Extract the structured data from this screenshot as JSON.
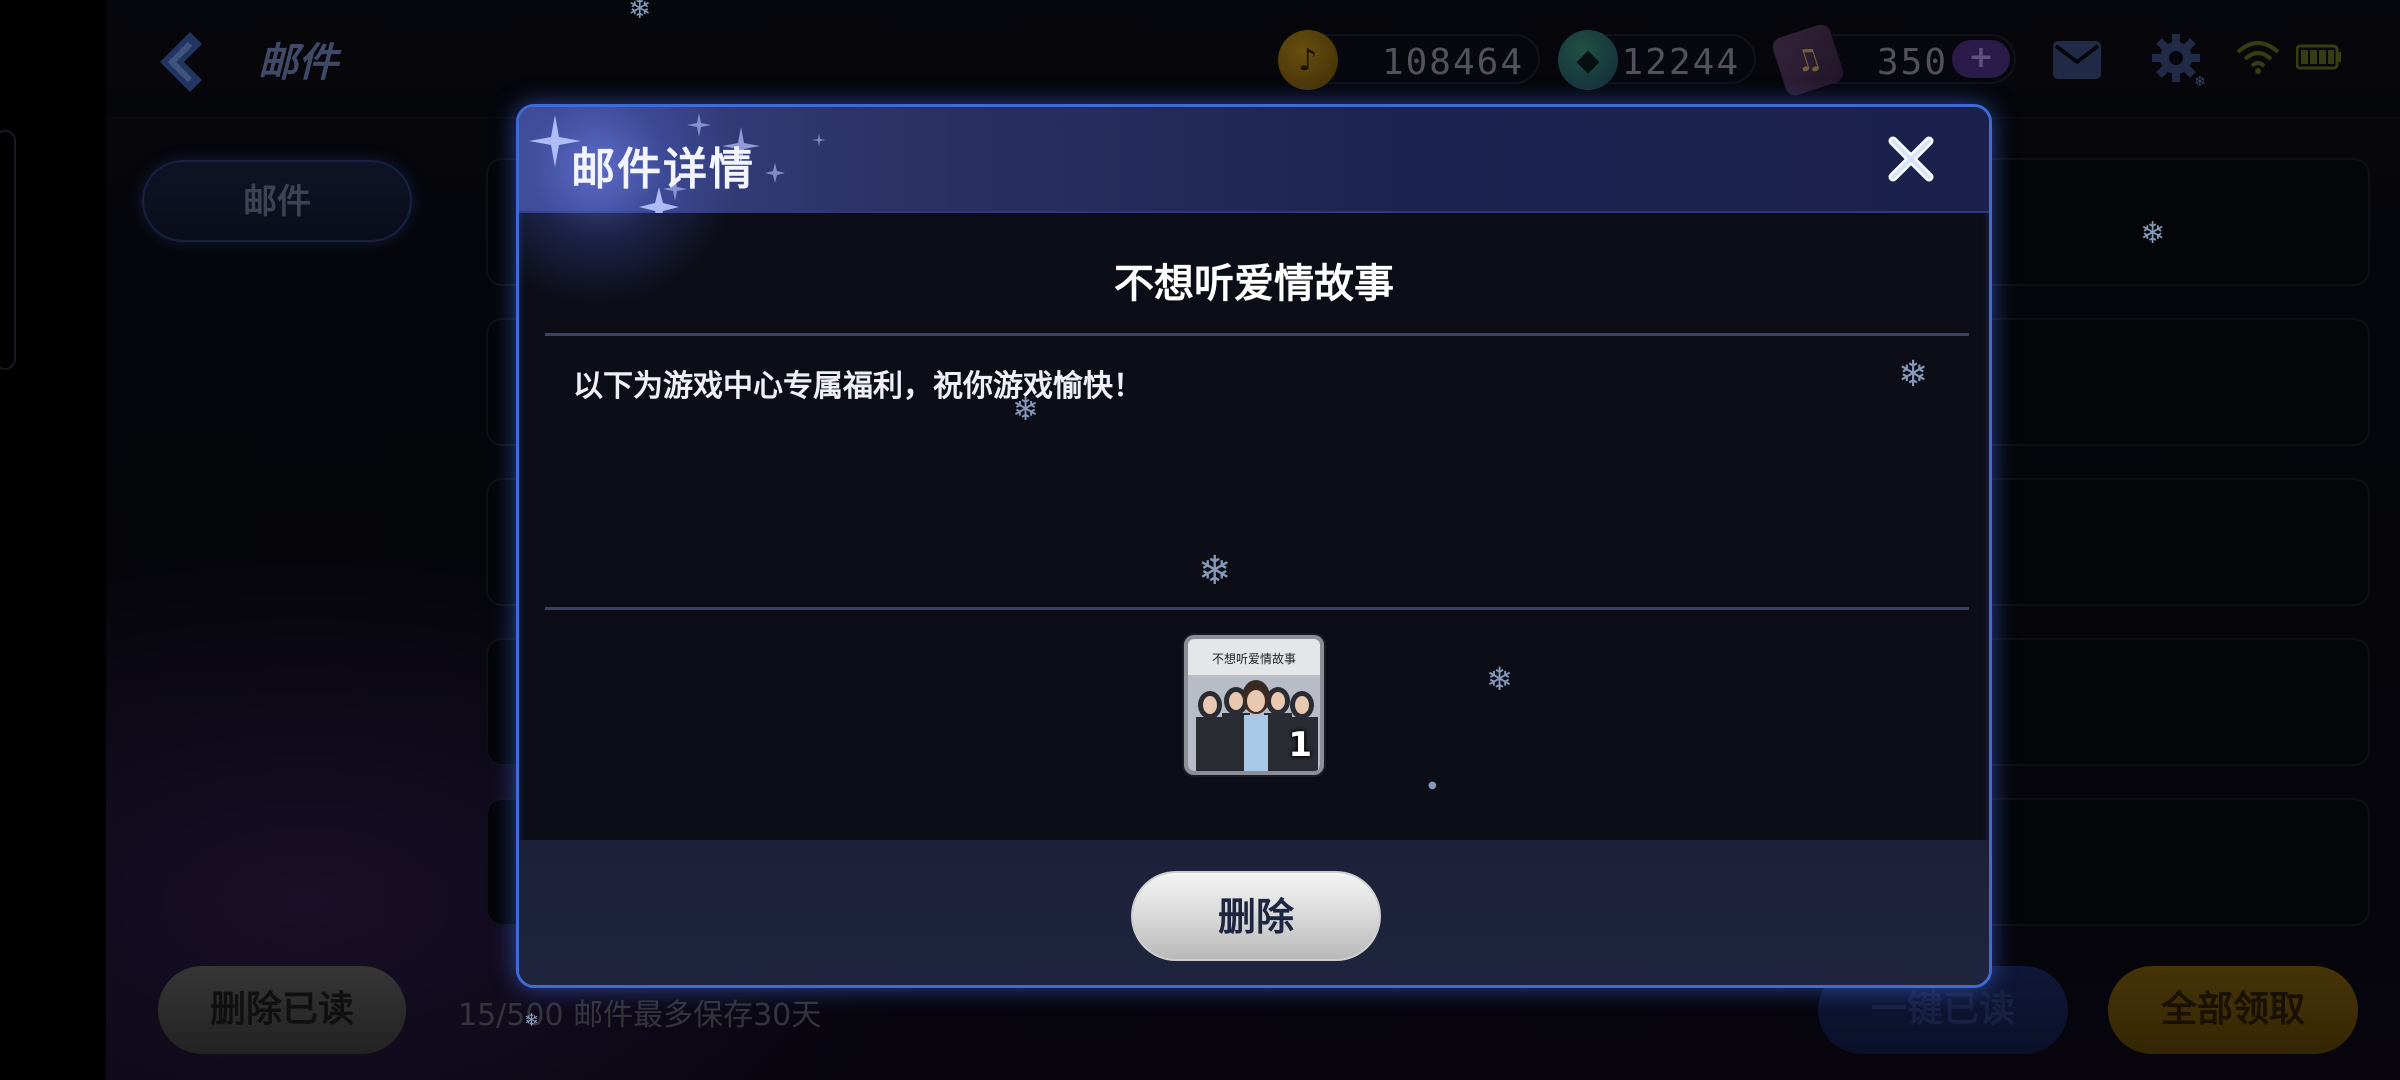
{
  "topbar": {
    "title": "邮件",
    "gold_amount": "108464",
    "gem_amount": "12244",
    "ticket_amount": "350",
    "plus_label": "+"
  },
  "sidebar": {
    "tab_label": "邮件"
  },
  "footer": {
    "delete_read_label": "删除已读",
    "storage_info": "15/500 邮件最多保存30天",
    "read_all_label": "一键已读",
    "claim_all_label": "全部领取"
  },
  "modal": {
    "title": "邮件详情",
    "subject": "不想听爱情故事",
    "body": "以下为游戏中心专属福利，祝你游戏愉快！",
    "attachment": {
      "title_text": "不想听爱情故事",
      "count": "1"
    },
    "delete_label": "删除"
  },
  "colors": {
    "modal_border": "#3f6ad8",
    "accent_blue": "#4a7cff",
    "gold": "#7a5b0d"
  },
  "icons": [
    "back-arrow-icon",
    "gold-coin-icon",
    "gem-icon",
    "ticket-icon",
    "mail-icon",
    "gear-icon",
    "wifi-icon",
    "battery-icon",
    "close-icon",
    "snowflake-icon"
  ]
}
